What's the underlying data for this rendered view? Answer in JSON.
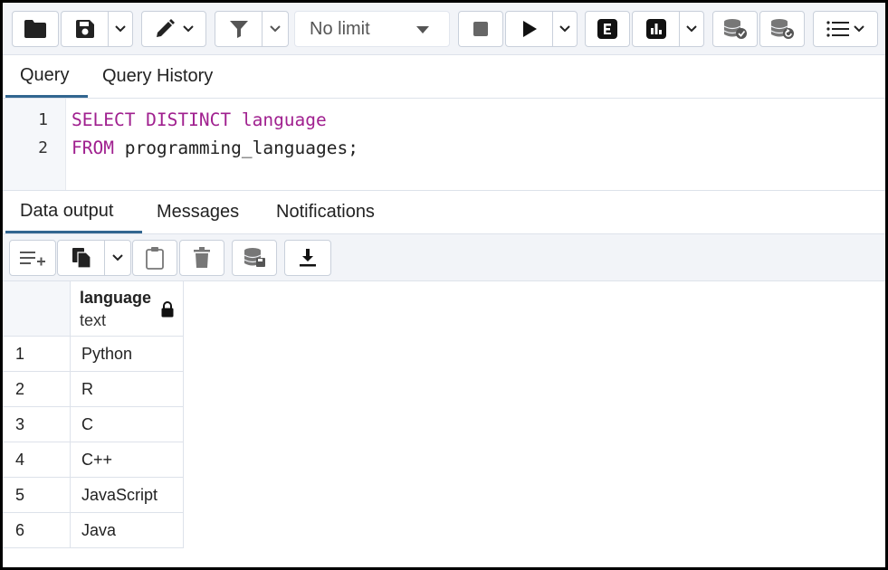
{
  "toolbar": {
    "buttons": [
      "open-file",
      "save-file",
      "edit",
      "filter",
      "stop",
      "execute",
      "explain",
      "explain-analyze",
      "commit",
      "rollback",
      "macros"
    ],
    "limit": {
      "selected": "No limit"
    }
  },
  "editor_tabs": [
    {
      "label": "Query",
      "active": true
    },
    {
      "label": "Query History",
      "active": false
    }
  ],
  "editor": {
    "lines": [
      {
        "number": "1",
        "keyword": "SELECT DISTINCT",
        "rest": " language"
      },
      {
        "number": "2",
        "keyword": "FROM",
        "rest": " programming_languages;"
      }
    ]
  },
  "output_tabs": [
    {
      "label": "Data output",
      "active": true
    },
    {
      "label": "Messages",
      "active": false
    },
    {
      "label": "Notifications",
      "active": false
    }
  ],
  "grid": {
    "column": {
      "name": "language",
      "type": "text"
    },
    "rows": [
      {
        "num": "1",
        "value": "Python"
      },
      {
        "num": "2",
        "value": "R"
      },
      {
        "num": "3",
        "value": "C"
      },
      {
        "num": "4",
        "value": "C++"
      },
      {
        "num": "5",
        "value": "JavaScript"
      },
      {
        "num": "6",
        "value": "Java"
      }
    ]
  },
  "colors": {
    "keyword": "#a0208f",
    "accent": "#326690",
    "toolbar_bg": "#f2f4f8"
  }
}
